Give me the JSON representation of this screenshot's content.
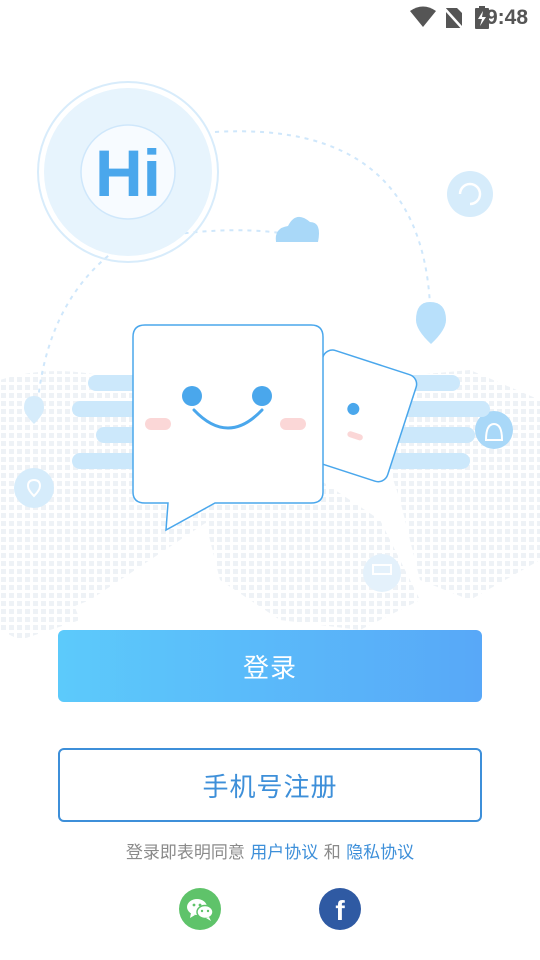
{
  "status_bar": {
    "time": "9:48",
    "icons": [
      "wifi-icon",
      "no-sim-icon",
      "battery-charging-icon"
    ]
  },
  "illustration": {
    "hi_text": "Hi"
  },
  "buttons": {
    "login_label": "登录",
    "register_label": "手机号注册"
  },
  "agreement": {
    "prefix": "登录即表明同意",
    "user_agreement": "用户协议",
    "conjunction": "和",
    "privacy_policy": "隐私协议"
  },
  "social": {
    "wechat_icon": "wechat-icon",
    "facebook_icon": "facebook-icon",
    "facebook_glyph": "f"
  },
  "colors": {
    "primary": "#3d8fd9",
    "gradient_start": "#5ccafb",
    "gradient_end": "#58a8f8",
    "wechat": "#5fc36a",
    "facebook": "#2f5aa3"
  }
}
